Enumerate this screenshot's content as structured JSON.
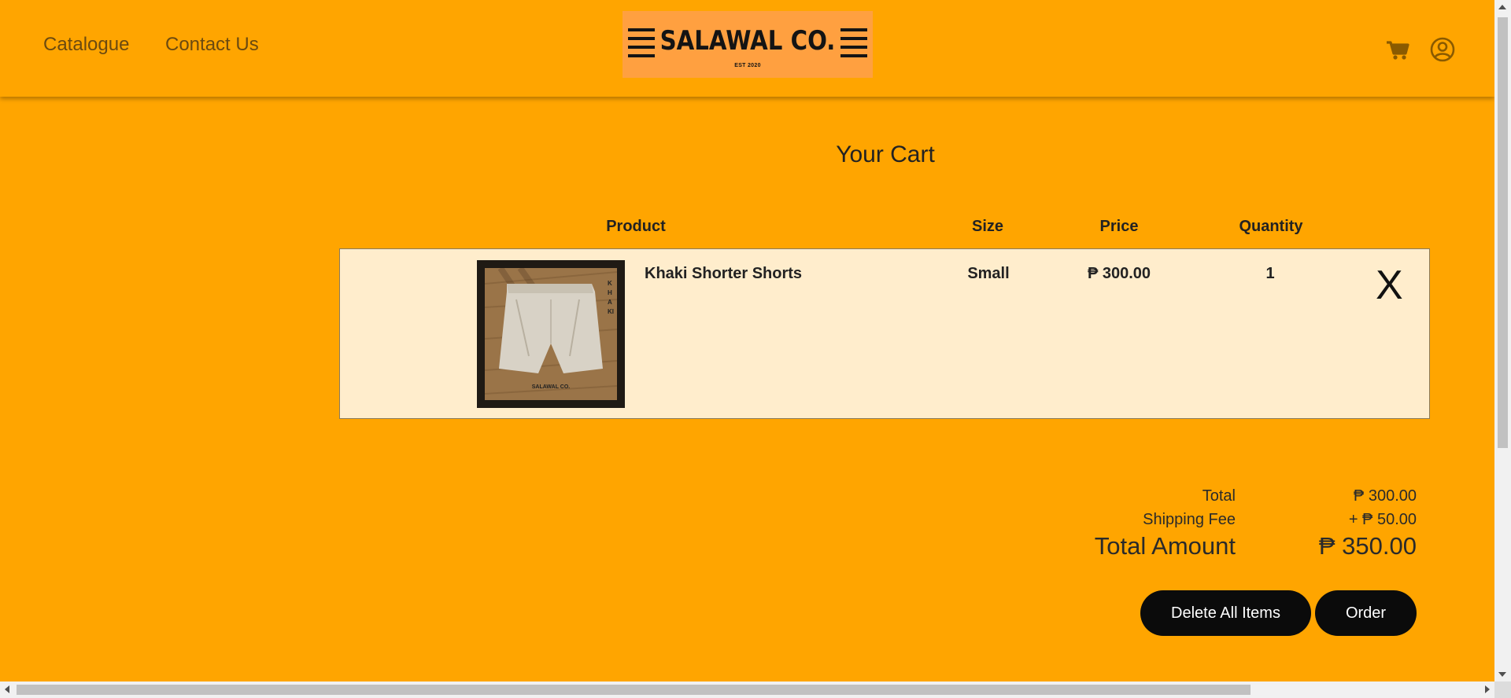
{
  "nav": {
    "catalogue": "Catalogue",
    "contact": "Contact Us"
  },
  "logo": {
    "name": "SALAWAL CO.",
    "est": "EST 2020"
  },
  "header_icons": [
    "cart-icon",
    "user-account-icon"
  ],
  "cart": {
    "title": "Your Cart",
    "columns": [
      "Product",
      "Size",
      "Price",
      "Quantity"
    ],
    "items": [
      {
        "image_brand": "SALAWAL CO.",
        "image_tag": "KHAKI",
        "name": "Khaki Shorter Shorts",
        "size": "Small",
        "price": "₱ 300.00",
        "quantity": "1",
        "remove": "X"
      }
    ]
  },
  "summary": {
    "total_label": "Total",
    "total_value": "₱ 300.00",
    "shipping_label": "Shipping Fee",
    "shipping_value": "+ ₱ 50.00",
    "amount_label": "Total Amount",
    "amount_value": "₱ 350.00"
  },
  "actions": {
    "delete_all": "Delete All Items",
    "order": "Order"
  },
  "colors": {
    "background": "#FFA500",
    "row_background": "#FFEDCC",
    "button": "#0b0b0b",
    "logo_box": "#FFA040"
  }
}
